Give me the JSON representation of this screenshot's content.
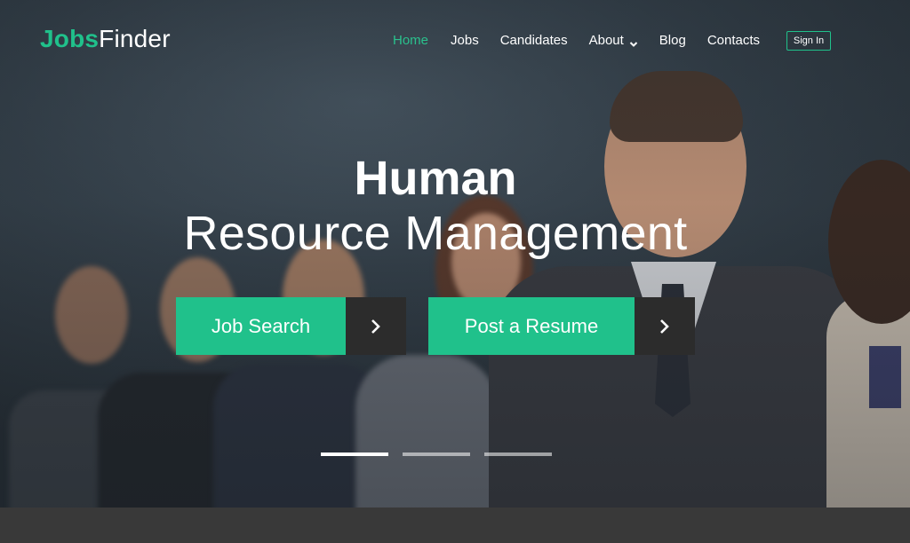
{
  "brand": {
    "name_bold": "Jobs",
    "name_rest": "Finder"
  },
  "nav": {
    "items": [
      {
        "label": "Home",
        "active": true
      },
      {
        "label": "Jobs"
      },
      {
        "label": "Candidates"
      },
      {
        "label": "About",
        "dropdown": true
      },
      {
        "label": "Blog"
      },
      {
        "label": "Contacts"
      }
    ],
    "sign_in_label": "Sign In"
  },
  "hero": {
    "title_line1": "Human",
    "title_line2": "Resource Management",
    "buttons": [
      {
        "label": "Job Search",
        "icon": "chevron-right-icon"
      },
      {
        "label": "Post a Resume",
        "icon": "chevron-right-icon"
      }
    ],
    "slides": {
      "count": 3,
      "active_index": 0
    }
  },
  "colors": {
    "accent": "#20c18b",
    "button_dark": "#2c2c2c",
    "footer_bar": "#393939"
  }
}
